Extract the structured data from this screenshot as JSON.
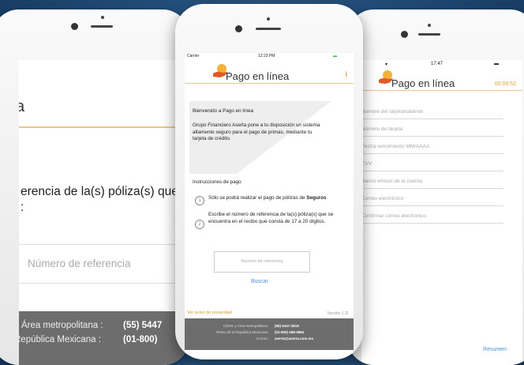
{
  "left_screen": {
    "title_partial": "a",
    "heading_line1": "erencia de la(s) póliza(s) que",
    "heading_line2": ":",
    "input_placeholder": "Número de referencia",
    "footer": [
      {
        "label": "y Área metropolitana :",
        "value": "(55) 5447"
      },
      {
        "label": "República Mexicana :",
        "value": "(01-800)"
      }
    ]
  },
  "center_screen": {
    "status": {
      "carrier": "Carrier",
      "time": "12:23 PM"
    },
    "app_title": "Pago en línea",
    "info_icon": "i",
    "welcome_title": "Bienvenido a Pago en línea",
    "welcome_body": "Grupo Financiero Aserta pone a tu disposición un sistema altamente seguro para el pago de primas, mediante tu tarjeta de crédito.",
    "instructions_title": "Instrucciones de pago",
    "steps": [
      {
        "num": "1",
        "text": "Sólo se podrá realizar el pago de pólizas de",
        "bold": "Seguros"
      },
      {
        "num": "2",
        "text": "Escribe el número de referencia de la(s) póliza(s) que se encuentra en el recibo que consta de 17 a 20 dígitos.",
        "bold": ""
      }
    ],
    "input_placeholder": "Número de referencia",
    "search_label": "Buscar",
    "privacy_link": "Ver aviso de privacidad",
    "version": "Versión 1.11",
    "footer": [
      {
        "label": "CDMX y Área metropolitana:",
        "value": "(55) 5447-3818"
      },
      {
        "label": "Resto de la República Mexicana:",
        "value": "(01-800) 288-0884"
      },
      {
        "label": "Correo:",
        "value": "aserta@aserta.com.mx"
      }
    ]
  },
  "right_screen": {
    "status": {
      "time": "17:47"
    },
    "app_title": "Pago en línea",
    "timer": "00:09:52",
    "fields": [
      "Nombre del tarjetahabiente",
      "Número de tarjeta",
      "Fecha vencimiento MM/AAAA",
      "CVV",
      "Banco emisor de la cuenta",
      "Correo electrónico",
      "Confirmar correo electrónico"
    ],
    "summary_label": "Resumen"
  },
  "colors": {
    "background": "#234f7c",
    "accent_orange": "#e2a33a",
    "link_blue": "#4a8fd4",
    "footer_gray": "#6d6d6d"
  }
}
